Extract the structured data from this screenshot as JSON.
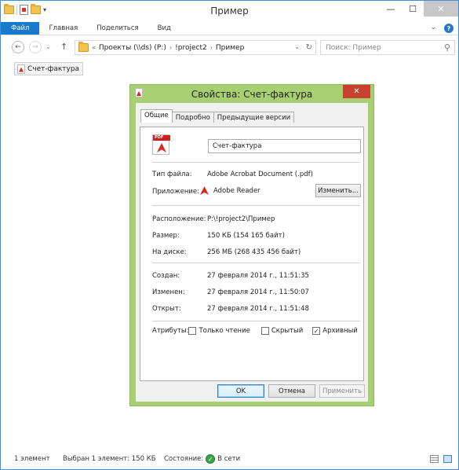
{
  "window": {
    "title": "Пример",
    "controls": {
      "minimize": "—",
      "maximize": "☐",
      "close": "✕"
    }
  },
  "ribbon": {
    "tabs": [
      "Файл",
      "Главная",
      "Поделиться",
      "Вид"
    ],
    "expand": "⌄",
    "help": "?"
  },
  "navigation": {
    "back": "←",
    "forward": "→",
    "recent": "⌄",
    "up": "↑",
    "path_prefix": "«",
    "breadcrumb": [
      "Проекты (\\\\ds) (P:)",
      "!project2",
      "Пример"
    ],
    "breadcrumb_sep": "›",
    "dropdown": "⌄",
    "refresh": "↻",
    "search_placeholder": "Поиск: Пример",
    "search_icon": "⚲"
  },
  "files": [
    {
      "name": "Счет-фактура",
      "icon": "pdf-icon"
    }
  ],
  "status_bar": {
    "count": "1 элемент",
    "selected": "Выбран 1 элемент: 150 КБ",
    "state_label": "Состояние:",
    "state_value": "В сети"
  },
  "dialog": {
    "title": "Свойства: Счет-фактура",
    "close": "✕",
    "tabs": [
      "Общие",
      "Подробно",
      "Предыдущие версии"
    ],
    "active_tab": "Общие",
    "icon_band": "PDF",
    "file_name": "Счет-фактура",
    "type_label": "Тип файла:",
    "type_value": "Adobe Acrobat Document (.pdf)",
    "app_label": "Приложение:",
    "app_value": "Adobe Reader",
    "change_button": "Изменить...",
    "location_label": "Расположение:",
    "location_value": "P:\\!project2\\Пример",
    "size_label": "Размер:",
    "size_value": "150 КБ (154 165 байт)",
    "disk_label": "На диске:",
    "disk_value": "256 МБ (268 435 456 байт)",
    "created_label": "Создан:",
    "created_value": "27 февраля 2014 г., 11:51:35",
    "modified_label": "Изменен:",
    "modified_value": "27 февраля 2014 г., 11:50:07",
    "opened_label": "Открыт:",
    "opened_value": "27 февраля 2014 г., 11:51:48",
    "attributes_label": "Атрибуты:",
    "attributes": [
      {
        "label": "Только чтение",
        "checked": false
      },
      {
        "label": "Скрытый",
        "checked": false
      },
      {
        "label": "Архивный",
        "checked": true
      }
    ],
    "ok": "OK",
    "cancel": "Отмена",
    "apply": "Применить"
  }
}
